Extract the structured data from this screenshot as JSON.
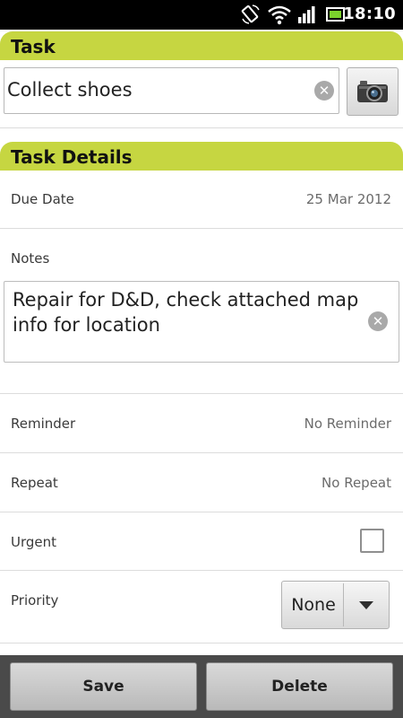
{
  "status_bar": {
    "time": "18:10",
    "icons": [
      "screen-rotation-icon",
      "wifi-icon",
      "signal-icon",
      "battery-icon"
    ]
  },
  "task_section": {
    "title": "Task",
    "task_name_value": "Collect shoes",
    "clear_icon": "clear-icon",
    "camera_icon": "camera-icon"
  },
  "details_section": {
    "title": "Task Details",
    "due_date": {
      "label": "Due Date",
      "value": "25 Mar 2012"
    },
    "notes": {
      "label": "Notes",
      "value": "Repair for D&D, check attached map info for location"
    },
    "reminder": {
      "label": "Reminder",
      "value": "No Reminder"
    },
    "repeat": {
      "label": "Repeat",
      "value": "No Repeat"
    },
    "urgent": {
      "label": "Urgent",
      "checked": false
    },
    "priority": {
      "label": "Priority",
      "value": "None"
    }
  },
  "actions": {
    "save_label": "Save",
    "delete_label": "Delete"
  },
  "colors": {
    "accent": "#c6d641",
    "status_bar_bg": "#000000",
    "bottom_bar_bg": "#4a4a4a"
  }
}
